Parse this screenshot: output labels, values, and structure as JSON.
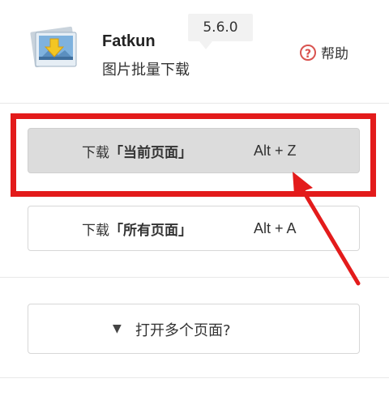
{
  "app": {
    "name": "Fatkun",
    "description": "图片批量下载",
    "version": "5.6.0"
  },
  "header": {
    "help_label": "帮助",
    "help_icon_char": "?"
  },
  "buttons": {
    "current": {
      "prefix": "下载",
      "keyword": "「当前页面」",
      "shortcut": "Alt + Z"
    },
    "all": {
      "prefix": "下载",
      "keyword": "「所有页面」",
      "shortcut": "Alt + A"
    }
  },
  "expand": {
    "caret": "▼",
    "label": "打开多个页面?"
  },
  "colors": {
    "annotation_red": "#e31b1b",
    "help_red": "#d9534f",
    "active_bg": "#dcdcdc"
  },
  "icons": {
    "logo": "fatkun-logo-icon",
    "help": "question-circle-icon",
    "caret": "caret-down-icon"
  }
}
